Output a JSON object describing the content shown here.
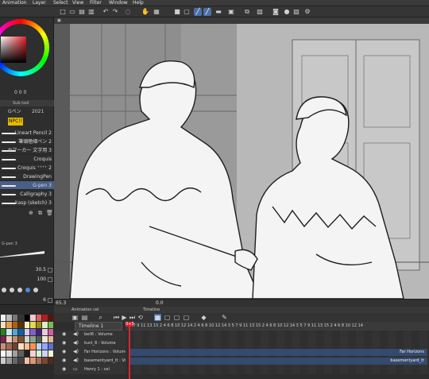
{
  "menubar": {
    "items": [
      "Animation",
      "Layer",
      "Select",
      "View",
      "Filter",
      "Window",
      "Help"
    ]
  },
  "toolbar": {
    "icons": [
      "new-icon",
      "open-icon",
      "save-icon",
      "undo-icon",
      "redo-icon",
      "lasso-icon",
      "hand-icon",
      "grid-icon",
      "pen-icon",
      "pen-active-icon",
      "ruler-icon",
      "frame-icon",
      "camera-icon",
      "gear-icon"
    ]
  },
  "color_panel": {
    "rgb_readout": "0   0   0 "
  },
  "subtool": {
    "header": "Sub tool",
    "tabs": [
      {
        "label": "Gペン"
      },
      {
        "label": "2021"
      },
      {
        "label": "NPC!!"
      }
    ]
  },
  "brushes": [
    {
      "label": "Lineart Pencil 2"
    },
    {
      "label": "筆頭極細ペン 2"
    },
    {
      "label": "カマーカー 文字用 3"
    },
    {
      "label": "Croquis"
    },
    {
      "label": "Croquis ⁺⁺⁺⁺ 2"
    },
    {
      "label": "DrawingPen"
    },
    {
      "label": "G-pen 3"
    },
    {
      "label": "Calligraphy 3"
    },
    {
      "label": "kasp (sketch) 3"
    }
  ],
  "brush_size": {
    "title": "G-pen 3",
    "size": "30.5",
    "opacity": "100",
    "stabilization": "6"
  },
  "navigator": {
    "zoom": "65.3",
    "angle": "0.0"
  },
  "timeline": {
    "tabs": [
      "Animation cel",
      "Timeline"
    ],
    "selected": "Timeline 1",
    "ruler": "3 5 7 9 11 13 15 2 4 6 8 10 12 14 2 4 6 8 10 12 14 3 5 7 9 11 13 15 2 4 6 8 10 12 14 3 5 7 9 11 13 15 2 4 6 8 10 12 14",
    "playhead": "0+3",
    "tracks": [
      {
        "name": "bell6 : Volume",
        "clip": ""
      },
      {
        "name": "kunl_8 : Volume",
        "clip": ""
      },
      {
        "name": "Far Horizons : Volume",
        "clip": "Far Horizons"
      },
      {
        "name": "basementyard_tt : Vol",
        "clip": "basementyard_tt"
      },
      {
        "name": "Henry  1 : cel",
        "clip": ""
      }
    ]
  }
}
